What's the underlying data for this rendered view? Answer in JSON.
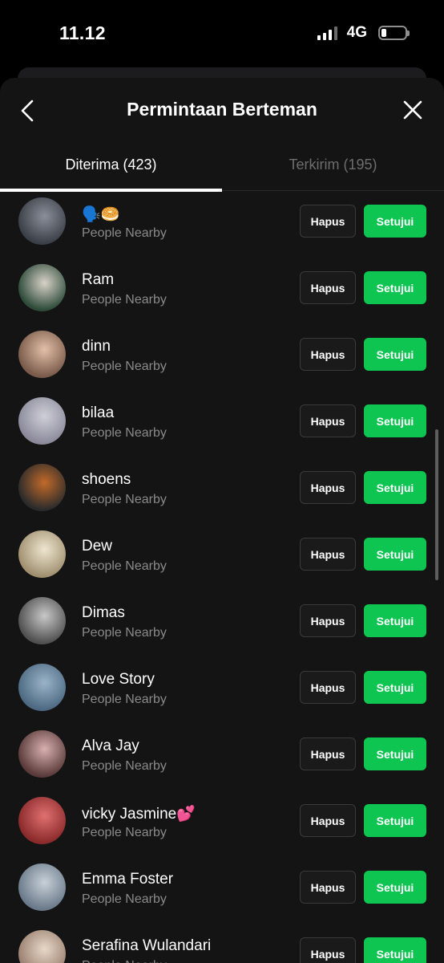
{
  "status_bar": {
    "time": "11.12",
    "network": "4G"
  },
  "header": {
    "title": "Permintaan Berteman"
  },
  "tabs": {
    "received": "Diterima (423)",
    "sent": "Terkirim (195)"
  },
  "buttons": {
    "delete": "Hapus",
    "approve": "Setujui"
  },
  "colors": {
    "approve": "#0fc552",
    "background": "#141414"
  },
  "requests": [
    {
      "name": "🗣️🥯",
      "subtitle": "People Nearby"
    },
    {
      "name": "Ram",
      "subtitle": "People Nearby"
    },
    {
      "name": "dinn",
      "subtitle": "People Nearby"
    },
    {
      "name": "bilaa",
      "subtitle": "People Nearby"
    },
    {
      "name": "shoens",
      "subtitle": "People Nearby"
    },
    {
      "name": "Dew",
      "subtitle": "People Nearby"
    },
    {
      "name": "Dimas",
      "subtitle": "People Nearby"
    },
    {
      "name": "Love Story",
      "subtitle": "People Nearby"
    },
    {
      "name": "Alva Jay",
      "subtitle": "People Nearby"
    },
    {
      "name": "vicky Jasmine💕",
      "subtitle": "People Nearby"
    },
    {
      "name": "Emma Foster",
      "subtitle": "People Nearby"
    },
    {
      "name": "Serafina Wulandari",
      "subtitle": "People Nearby"
    }
  ]
}
